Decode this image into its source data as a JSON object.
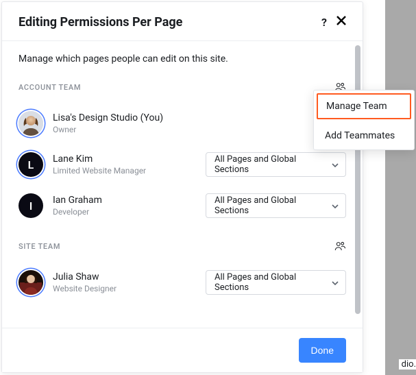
{
  "header": {
    "title": "Editing Permissions Per Page"
  },
  "subtitle": "Manage which pages people can edit on this site.",
  "sections": {
    "account": {
      "title": "ACCOUNT TEAM"
    },
    "site": {
      "title": "SITE TEAM"
    }
  },
  "members": {
    "account": [
      {
        "name": "Lisa's Design Studio (You)",
        "role": "Owner",
        "initial": "",
        "avatar_type": "photo1",
        "has_select": false,
        "ringed": true
      },
      {
        "name": "Lane Kim",
        "role": "Limited Website Manager",
        "initial": "L",
        "avatar_type": "letter",
        "has_select": true,
        "ringed": true
      },
      {
        "name": "Ian Graham",
        "role": "Developer",
        "initial": "I",
        "avatar_type": "letter",
        "has_select": true,
        "ringed": false
      }
    ],
    "site": [
      {
        "name": "Julia Shaw",
        "role": "Website Designer",
        "initial": "",
        "avatar_type": "photo2",
        "has_select": true,
        "ringed": true
      }
    ]
  },
  "select_label": "All Pages and Global Sections",
  "popover": {
    "items": [
      {
        "label": "Manage Team",
        "highlighted": true
      },
      {
        "label": "Add Teammates",
        "highlighted": false
      }
    ]
  },
  "footer": {
    "done": "Done"
  },
  "corner_fragment": "dio."
}
